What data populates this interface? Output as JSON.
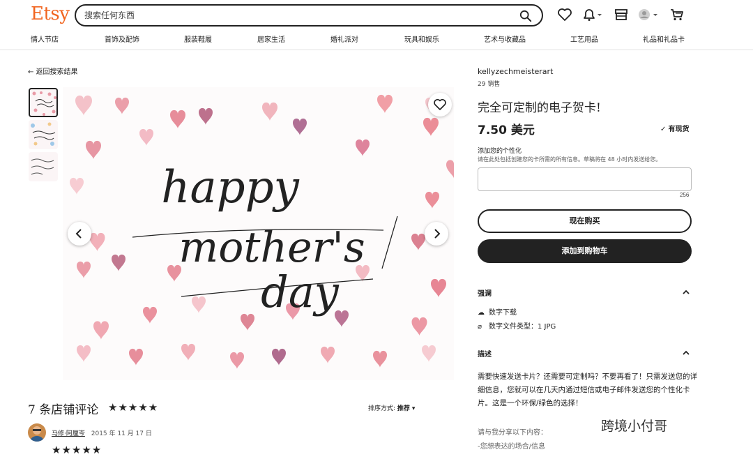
{
  "header": {
    "logo": "Etsy",
    "search_placeholder": "搜索任何东西",
    "nav": [
      "情人节店",
      "首饰及配饰",
      "服装鞋履",
      "居家生活",
      "婚礼派对",
      "玩具和娱乐",
      "艺术与收藏品",
      "工艺用品",
      "礼品和礼品卡"
    ]
  },
  "listing": {
    "back_label": "返回搜索结果",
    "image_text": [
      "happy",
      "mother's",
      "day"
    ]
  },
  "reviews": {
    "title": "7 条店铺评论",
    "stars": "★★★★★",
    "sort_label": "排序方式:",
    "sort_value": "推荐",
    "reviewer_name": "马修·阿厘岑",
    "review_date": "2015 年 11 月 17 日",
    "review_stars": "★★★★★"
  },
  "product": {
    "shop_name": "kellyzechmeisterart",
    "sales": "29 销售",
    "title": "完全可定制的电子贺卡!",
    "price": "7.50 美元",
    "stock": "有现货",
    "personalization_label": "添加您的个性化",
    "personalization_hint": "请在此处包括创建您的卡所需的所有信息。草稿将在 48 小时内发送给您。",
    "char_count": "256",
    "buy_now": "现在购买",
    "add_to_cart": "添加到购物车",
    "highlights_title": "强调",
    "highlights": [
      "数字下载",
      "数字文件类型：1 JPG"
    ],
    "description_title": "描述",
    "description": "需要快速发送卡片？还需要可定制吗？不要再看了！只需发送您的详细信息，您就可以在几天内通过短信或电子邮件发送您的个性化卡片。这是一个环保/绿色的选择！",
    "share_prompt": "请与我分享以下内容：",
    "share_item": "-您想表达的场合/信息"
  },
  "watermark": "跨境小付哥",
  "colors": {
    "brand": "#f1641e",
    "heart_pink": "#e8808f"
  }
}
